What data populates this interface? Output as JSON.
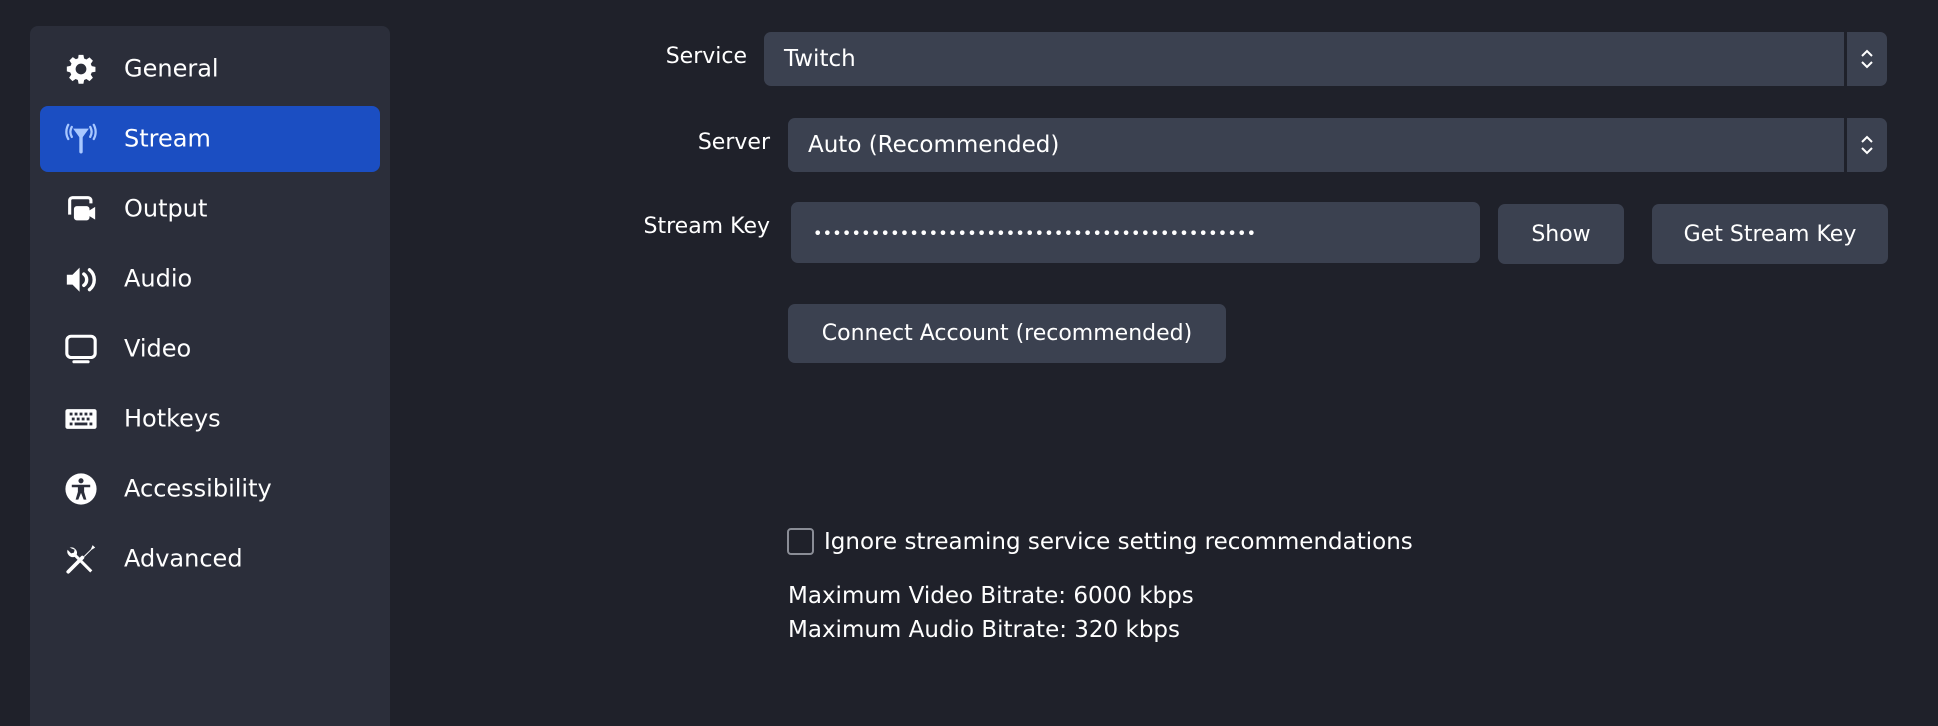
{
  "sidebar": {
    "items": [
      {
        "label": "General",
        "icon": "gear-icon",
        "active": false
      },
      {
        "label": "Stream",
        "icon": "antenna-icon",
        "active": true
      },
      {
        "label": "Output",
        "icon": "output-camera-icon",
        "active": false
      },
      {
        "label": "Audio",
        "icon": "speaker-icon",
        "active": false
      },
      {
        "label": "Video",
        "icon": "monitor-icon",
        "active": false
      },
      {
        "label": "Hotkeys",
        "icon": "keyboard-icon",
        "active": false
      },
      {
        "label": "Accessibility",
        "icon": "accessibility-icon",
        "active": false
      },
      {
        "label": "Advanced",
        "icon": "tools-icon",
        "active": false
      }
    ]
  },
  "form": {
    "service": {
      "label": "Service",
      "value": "Twitch"
    },
    "server": {
      "label": "Server",
      "value": "Auto (Recommended)"
    },
    "stream_key": {
      "label": "Stream Key",
      "value": "••••••••••••••••••••••••••••••••••••••••••••••"
    },
    "show_button": "Show",
    "get_key_button": "Get Stream Key",
    "connect_button": "Connect Account (recommended)",
    "ignore_checkbox": {
      "label": "Ignore streaming service setting recommendations",
      "checked": false
    },
    "max_video_bitrate": "Maximum Video Bitrate: 6000 kbps",
    "max_audio_bitrate": "Maximum Audio Bitrate: 320 kbps"
  },
  "colors": {
    "background": "#1f212a",
    "sidebar": "#2b2e3a",
    "accent": "#1b4ec2",
    "control": "#3b4150"
  }
}
